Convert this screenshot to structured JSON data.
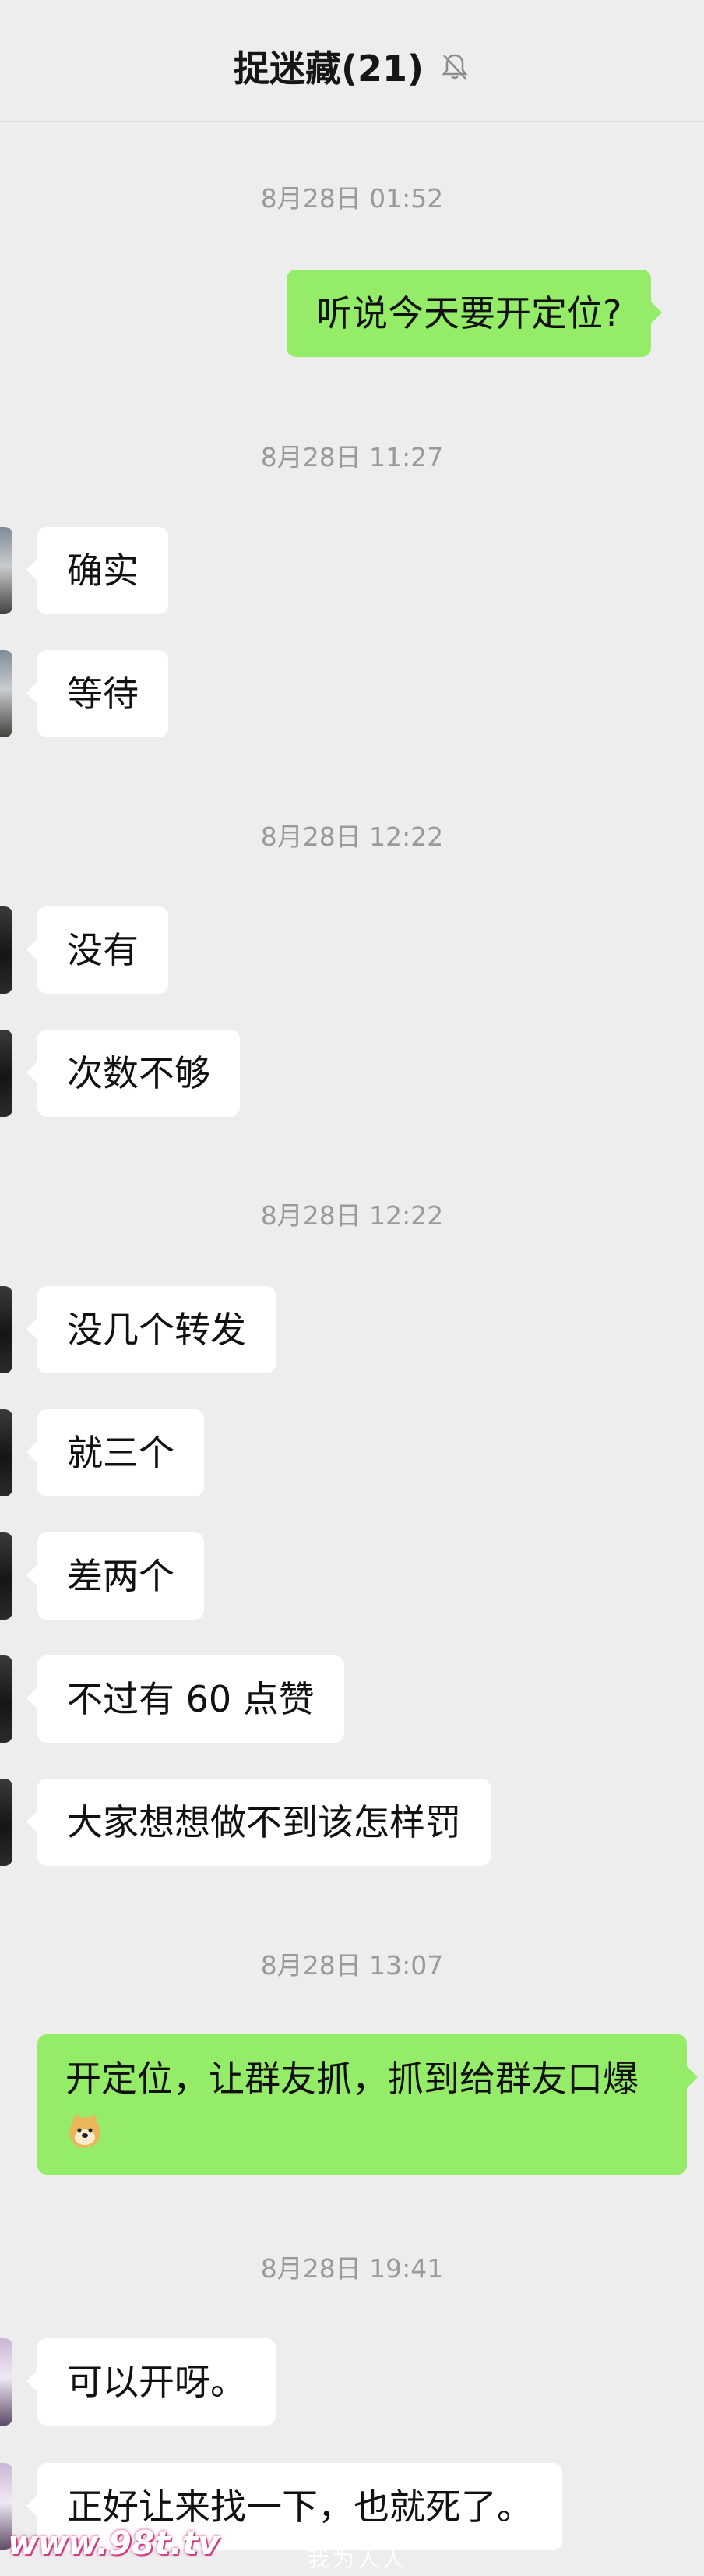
{
  "header": {
    "title": "捉迷藏(21)",
    "mute_icon": "bell-off-icon"
  },
  "messages": [
    {
      "type": "time",
      "text": "8月28日 01:52"
    },
    {
      "type": "sent",
      "text": "听说今天要开定位?"
    },
    {
      "type": "time",
      "text": "8月28日 11:27"
    },
    {
      "type": "recv",
      "text": "确实"
    },
    {
      "type": "recv",
      "text": "等待"
    },
    {
      "type": "time",
      "text": "8月28日 12:22"
    },
    {
      "type": "recv",
      "text": "没有"
    },
    {
      "type": "recv",
      "text": "次数不够"
    },
    {
      "type": "time",
      "text": "8月28日 12:22"
    },
    {
      "type": "recv",
      "text": "没几个转发"
    },
    {
      "type": "recv",
      "text": "就三个"
    },
    {
      "type": "recv",
      "text": "差两个"
    },
    {
      "type": "recv",
      "text": "不过有 60 点赞"
    },
    {
      "type": "recv",
      "text": "大家想想做不到该怎样罚"
    },
    {
      "type": "time",
      "text": "8月28日 13:07"
    },
    {
      "type": "sent",
      "text": "开定位，让群友抓，抓到给群友口爆",
      "emoji": "doge-emoji"
    },
    {
      "type": "time",
      "text": "8月28日 19:41"
    },
    {
      "type": "recv",
      "text": "可以开呀。"
    },
    {
      "type": "recv",
      "text": "正好让来找一下，也就死了。"
    }
  ],
  "watermark": {
    "logo": "www.98t.tv",
    "text": "我为人人"
  },
  "colors": {
    "background": "#ededed",
    "sent_bubble": "#95ec69",
    "recv_bubble": "#ffffff",
    "timestamp": "#9a9a9a"
  }
}
